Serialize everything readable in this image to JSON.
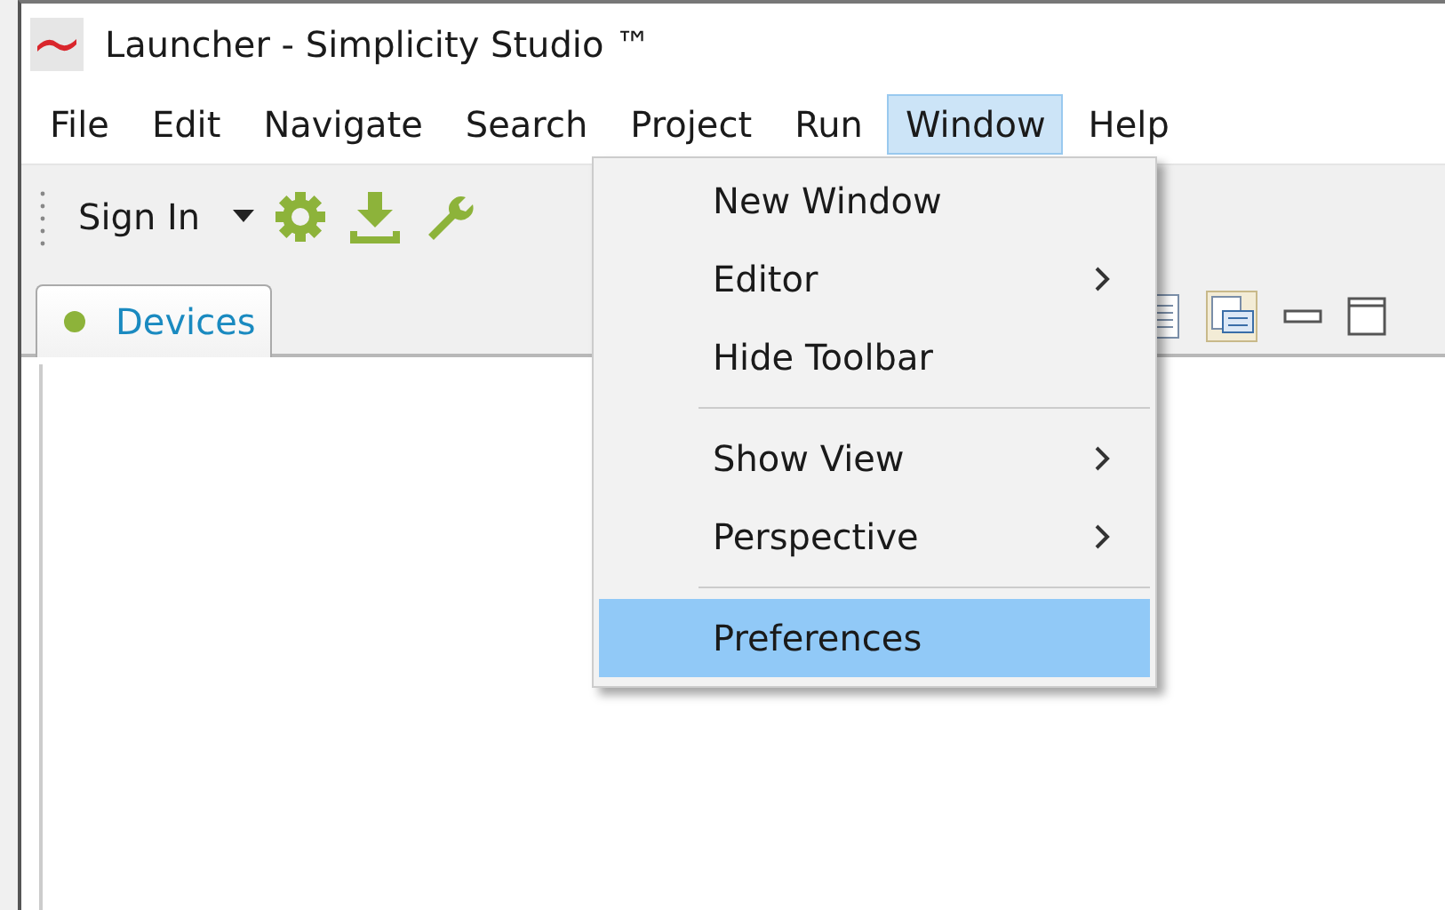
{
  "window": {
    "title": "Launcher - Simplicity Studio ™"
  },
  "menu_bar": [
    {
      "label": "File",
      "selected": false
    },
    {
      "label": "Edit",
      "selected": false
    },
    {
      "label": "Navigate",
      "selected": false
    },
    {
      "label": "Search",
      "selected": false
    },
    {
      "label": "Project",
      "selected": false
    },
    {
      "label": "Run",
      "selected": false
    },
    {
      "label": "Window",
      "selected": true
    },
    {
      "label": "Help",
      "selected": false
    }
  ],
  "toolbar": {
    "sign_in": "Sign In"
  },
  "tabs": [
    {
      "label": "Devices",
      "selected": true
    }
  ],
  "window_menu": [
    {
      "kind": "item",
      "label": "New Window",
      "submenu": false,
      "selected": false
    },
    {
      "kind": "item",
      "label": "Editor",
      "submenu": true,
      "selected": false
    },
    {
      "kind": "item",
      "label": "Hide Toolbar",
      "submenu": false,
      "selected": false
    },
    {
      "kind": "separator"
    },
    {
      "kind": "item",
      "label": "Show View",
      "submenu": true,
      "selected": false
    },
    {
      "kind": "item",
      "label": "Perspective",
      "submenu": true,
      "selected": false
    },
    {
      "kind": "separator"
    },
    {
      "kind": "item",
      "label": "Preferences",
      "submenu": false,
      "selected": true
    }
  ]
}
